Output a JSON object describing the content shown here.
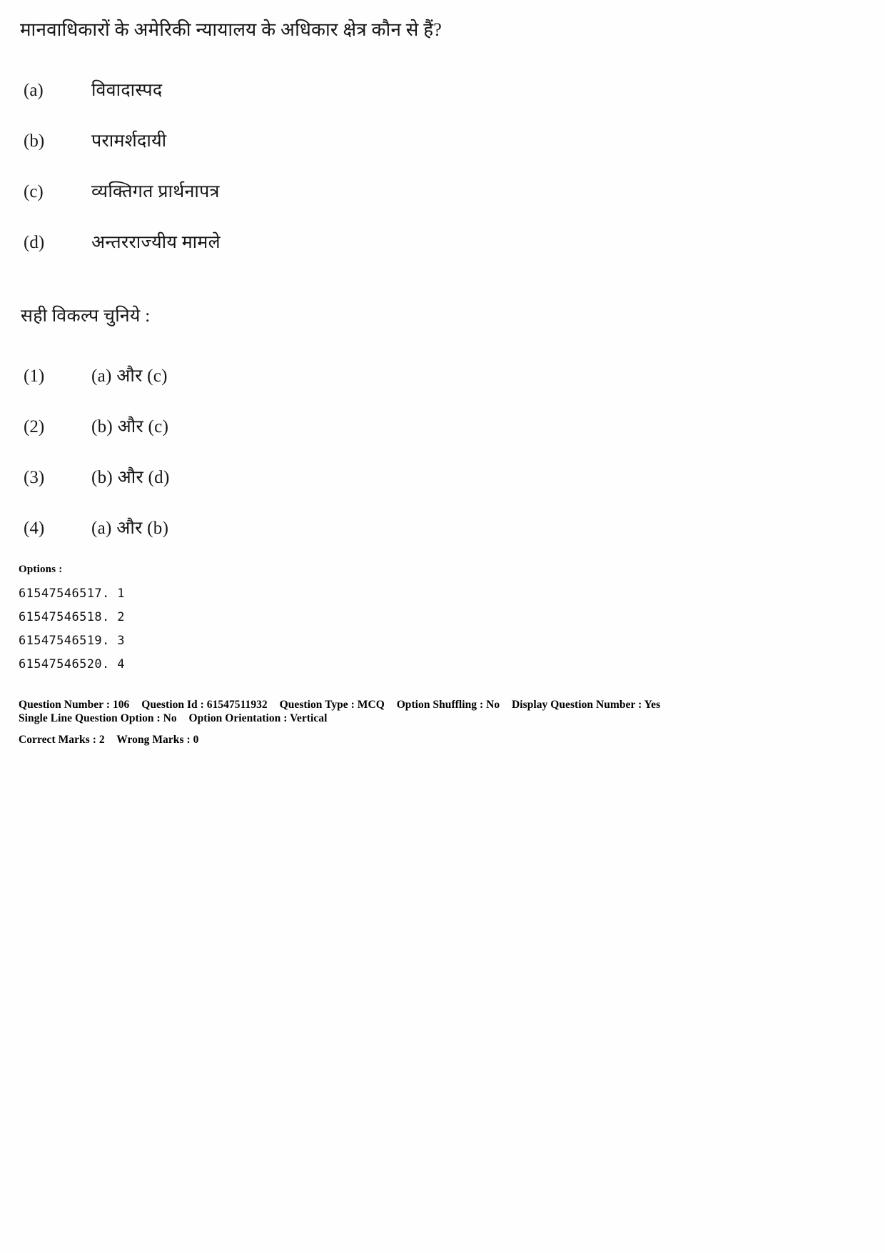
{
  "question": {
    "stem": "मानवाधिकारों के अमेरिकी न्यायालय के अधिकार क्षेत्र कौन से हैं?",
    "statements": [
      {
        "label": "(a)",
        "text": "विवादास्पद"
      },
      {
        "label": "(b)",
        "text": "परामर्शदायी"
      },
      {
        "label": "(c)",
        "text": "व्यक्तिगत प्रार्थनापत्र"
      },
      {
        "label": "(d)",
        "text": "अन्तरराज्यीय मामले"
      }
    ],
    "choose_prompt": "सही विकल्प चुनिये :",
    "choices": [
      {
        "number": "(1)",
        "text": "(a) और (c)"
      },
      {
        "number": "(2)",
        "text": "(b) और (c)"
      },
      {
        "number": "(3)",
        "text": "(b) और (d)"
      },
      {
        "number": "(4)",
        "text": "(a) और (b)"
      }
    ]
  },
  "options_block": {
    "heading": "Options :",
    "rows": [
      "61547546517. 1",
      "61547546518. 2",
      "61547546519. 3",
      "61547546520. 4"
    ]
  },
  "metadata": {
    "question_number_label": "Question Number : 106",
    "question_id_label": "Question Id : 61547511932",
    "question_type_label": "Question Type : MCQ",
    "option_shuffling_label": "Option Shuffling : No",
    "display_question_number_label": "Display Question Number : Yes",
    "single_line_question_option_label": "Single Line Question Option : No",
    "option_orientation_label": "Option Orientation : Vertical",
    "correct_marks_label": "Correct Marks : 2",
    "wrong_marks_label": "Wrong Marks : 0"
  }
}
